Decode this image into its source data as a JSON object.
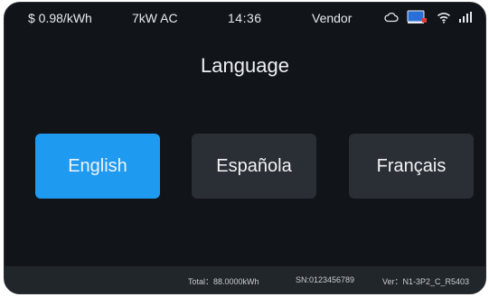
{
  "statusbar": {
    "price": "$ 0.98/kWh",
    "power": "7kW AC",
    "time": "14:36",
    "vendor": "Vendor",
    "icons": [
      "cloud-icon",
      "screen-alert-icon",
      "wifi-icon",
      "signal-icon"
    ]
  },
  "title": "Language",
  "languages": [
    {
      "label": "English",
      "selected": true
    },
    {
      "label": "Española",
      "selected": false
    },
    {
      "label": "Français",
      "selected": false
    }
  ],
  "footer": {
    "total": "Total：88.0000kWh",
    "sn": "SN:0123456789",
    "version": "Ver：N1-3P2_C_R5403"
  },
  "colors": {
    "selected": "#1e9af0",
    "unselected": "#2a2f35",
    "background": "#111419",
    "footer": "#21262b"
  }
}
